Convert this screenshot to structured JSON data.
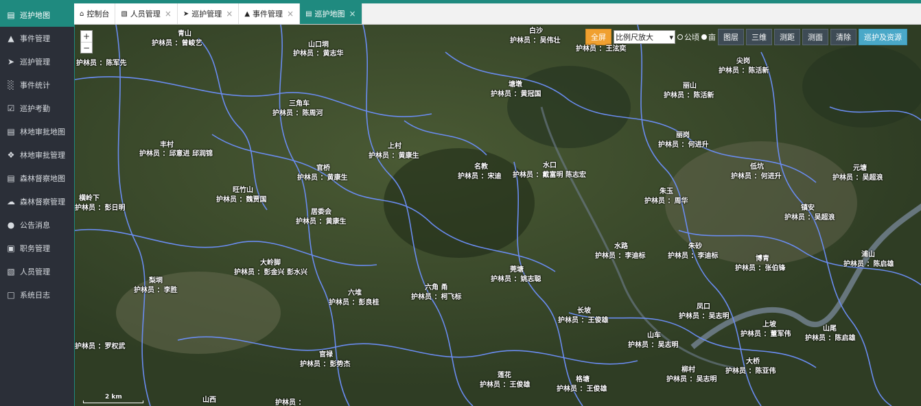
{
  "sidebar": {
    "items": [
      {
        "label": "巡护地图",
        "icon": "map-icon",
        "active": true
      },
      {
        "label": "事件管理",
        "icon": "warning-icon"
      },
      {
        "label": "巡护管理",
        "icon": "paper-plane-icon"
      },
      {
        "label": "事件统计",
        "icon": "bar-chart-icon"
      },
      {
        "label": "巡护考勤",
        "icon": "calendar-check-icon"
      },
      {
        "label": "林地审批地图",
        "icon": "map-icon"
      },
      {
        "label": "林地审批管理",
        "icon": "tags-icon"
      },
      {
        "label": "森林督察地图",
        "icon": "map-icon"
      },
      {
        "label": "森林督察管理",
        "icon": "cloud-upload-icon"
      },
      {
        "label": "公告消息",
        "icon": "comment-icon"
      },
      {
        "label": "职务管理",
        "icon": "briefcase-icon"
      },
      {
        "label": "人员管理",
        "icon": "id-card-icon"
      },
      {
        "label": "系统日志",
        "icon": "file-icon"
      }
    ]
  },
  "tabs": [
    {
      "label": "控制台",
      "icon": "home-icon",
      "closable": false
    },
    {
      "label": "人员管理",
      "icon": "id-card-icon",
      "closable": true
    },
    {
      "label": "巡护管理",
      "icon": "paper-plane-icon",
      "closable": true
    },
    {
      "label": "事件管理",
      "icon": "warning-icon",
      "closable": true
    },
    {
      "label": "巡护地图",
      "icon": "map-icon",
      "closable": true,
      "active": true
    }
  ],
  "toolbar": {
    "fullscreen": "全屏",
    "scale_select": "比例尺放大",
    "unit_gongqing": "公顷",
    "unit_mu": "亩",
    "layers": "图层",
    "three_d": "三维",
    "measure_distance": "测距",
    "measure_area": "测面",
    "clear": "清除",
    "patrol_resources": "巡护及资源"
  },
  "zoom": {
    "in": "+",
    "out": "−"
  },
  "scale_bar": "2 km",
  "colors": {
    "accent": "#1f8a7f",
    "boundary": "#6a8cf0",
    "orange": "#f0a030",
    "cyan": "#4aa8c8"
  },
  "labels": [
    "青山",
    "护林员 ：曾峻艺",
    "山口垌",
    "护林员 ：黄志华",
    "白沙",
    "护林员 ：吴伟壮",
    "护林员 ：王泫奕",
    "尖岗",
    "护林员 ：陈活新",
    "丽山",
    "护林员 ：陈活新",
    "塘墩",
    "护林员 ：黄冠国",
    "护林员 ：陈军先",
    "三角车",
    "护林员 ：陈周河",
    "丰村",
    "护林员 ：邱意进 邱润锦",
    "上村",
    "护林员 ：黄康生",
    "丽岗",
    "护林员 ：何进升",
    "官桥",
    "护林员 ：黄康生",
    "名教",
    "护林员 ：宋迪",
    "水口",
    "护林员 ：戴富明 陈志宏",
    "低坑",
    "护林员 ：何进升",
    "元塘",
    "护林员 ：吴超浪",
    "横岭下",
    "护林员 ：彭日明",
    "旺竹山",
    "护林员 ：魏贾国",
    "朱玉",
    "护林员 ：周华",
    "居委会",
    "护林员 ：黄康生",
    "镇安",
    "护林员 ：吴超浪",
    "水路",
    "护林员 ：李迪标",
    "朱砂",
    "护林员 ：李迪标",
    "大岭脚",
    "护林员 ：彭金兴 彭水兴",
    "博青",
    "护林员 ：张伯锋",
    "浦山",
    "护林员 ：陈启雄",
    "莞塘",
    "护林员 ：姚志聪",
    "梨垌",
    "护林员 ：李胜",
    "六角 甬",
    "护林员 ：柯飞标",
    "六堆",
    "护林员 ：彭良桂",
    "长坡",
    "护林员 ：王俊雄",
    "凤口",
    "护林员 ：吴志明",
    "上坡",
    "护林员 ：董军伟",
    "山车",
    "护林员 ：吴志明",
    "山尾",
    "护林员 ：陈启雄",
    "护林员 ：罗权武",
    "官禄",
    "护林员 ：彭势杰",
    "莲花",
    "护林员 ：王俊雄",
    "格塘",
    "护林员 ：王俊雄",
    "柳村",
    "护林员 ：吴志明",
    "大桥",
    "护林员 ：陈亚伟",
    "山西",
    "护林员 ："
  ]
}
